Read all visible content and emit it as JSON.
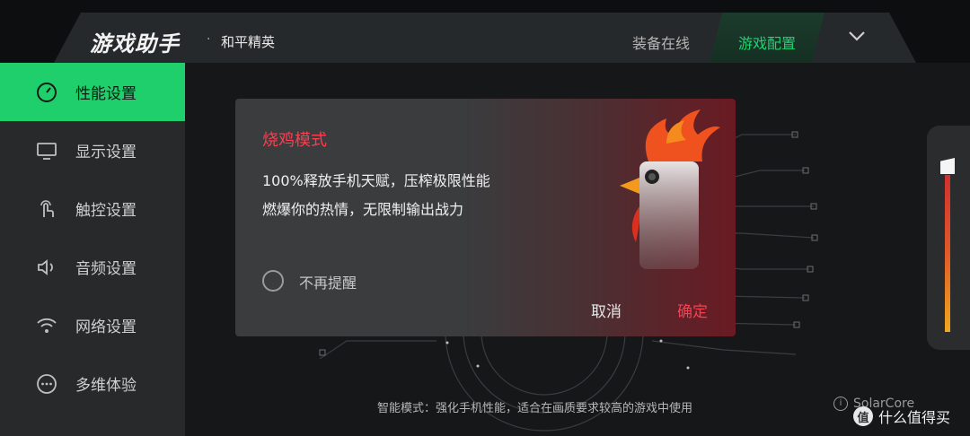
{
  "header": {
    "app_title": "游戏助手",
    "separator": "·",
    "game_name": "和平精英",
    "tabs": [
      {
        "label": "装备在线",
        "active": false
      },
      {
        "label": "游戏配置",
        "active": true
      }
    ],
    "chevron_icon": "chevron-down-icon"
  },
  "sidebar": {
    "items": [
      {
        "label": "性能设置",
        "icon": "speedometer-icon",
        "active": true
      },
      {
        "label": "显示设置",
        "icon": "monitor-icon",
        "active": false
      },
      {
        "label": "触控设置",
        "icon": "touch-icon",
        "active": false
      },
      {
        "label": "音频设置",
        "icon": "speaker-icon",
        "active": false
      },
      {
        "label": "网络设置",
        "icon": "wifi-icon",
        "active": false
      },
      {
        "label": "多维体验",
        "icon": "more-icon",
        "active": false
      }
    ]
  },
  "dialog": {
    "title": "烧鸡模式",
    "line1": "100%释放手机天赋，压榨极限性能",
    "line2": "燃爆你的热情，无限制输出战力",
    "checkbox_label": "不再提醒",
    "checkbox_checked": false,
    "cancel_label": "取消",
    "confirm_label": "确定"
  },
  "footer": {
    "mode_description": "智能模式：强化手机性能，适合在画质要求较高的游戏中使用",
    "solarcore_label": "SolarCore"
  },
  "watermark": {
    "badge": "值",
    "text": "什么值得买"
  },
  "colors": {
    "accent_green": "#1fcf6c",
    "accent_red": "#ff3d4f",
    "background": "#151719",
    "sidebar": "#27292b"
  }
}
